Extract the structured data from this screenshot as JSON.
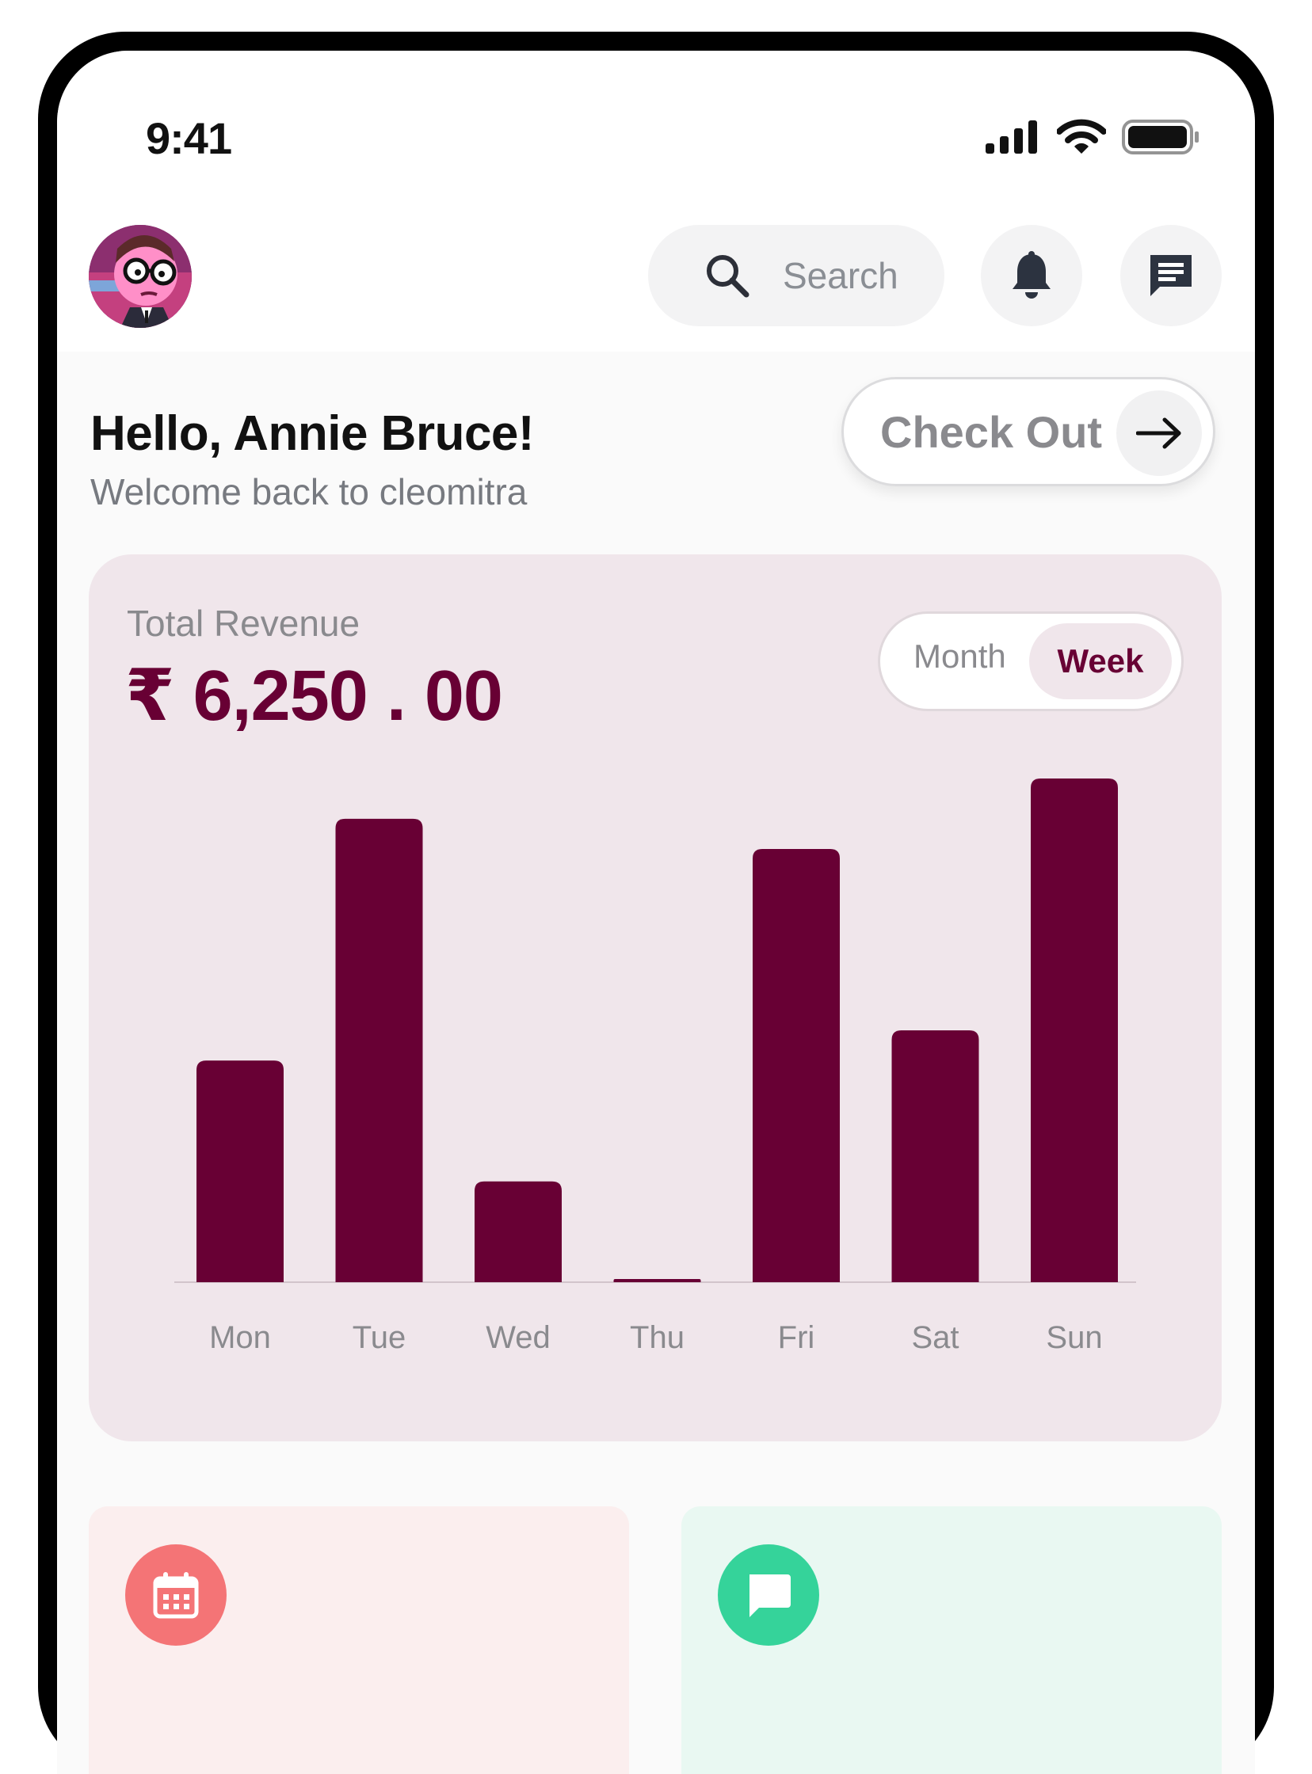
{
  "status_bar": {
    "time": "9:41",
    "icons": [
      "signal-icon",
      "wifi-icon",
      "battery-icon"
    ]
  },
  "header": {
    "avatar": "avatar",
    "search": {
      "label": "Search",
      "icon": "search-icon"
    },
    "notification_icon": "bell-icon",
    "messages_icon": "message-icon"
  },
  "greeting": {
    "title": "Hello, Annie Bruce!",
    "subtitle": "Welcome back to cleomitra"
  },
  "checkout_button": {
    "label": "Check Out",
    "icon": "arrow-right-icon"
  },
  "revenue": {
    "label": "Total Revenue",
    "amount": "₹ 6,250 . 00",
    "toggle": {
      "options": [
        "Month",
        "Week"
      ],
      "selected": "Week"
    }
  },
  "chart_data": {
    "type": "bar",
    "categories": [
      "Mon",
      "Tue",
      "Wed",
      "Thu",
      "Fri",
      "Sat",
      "Sun"
    ],
    "values": [
      44,
      92,
      20,
      0.5,
      86,
      50,
      100
    ],
    "title": "",
    "xlabel": "",
    "ylabel": "",
    "ylim": [
      0,
      100
    ],
    "grid": false,
    "bar_color": "#680034"
  },
  "bottom_cards": [
    {
      "icon": "calendar-icon",
      "icon_color": "#f47476",
      "bg": "#fbeeee"
    },
    {
      "icon": "chat-icon",
      "icon_color": "#35d39a",
      "bg": "#e9f8f2"
    }
  ],
  "colors": {
    "accent": "#680034",
    "card_bg": "#f0e6eb",
    "muted_text": "#8a8a8e"
  }
}
